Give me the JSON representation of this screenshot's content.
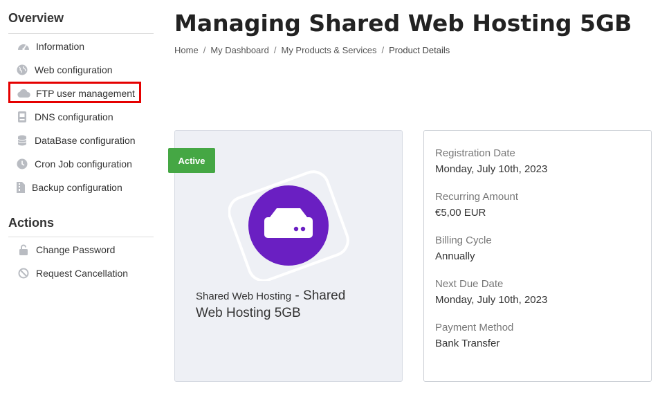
{
  "sidebar": {
    "overview_title": "Overview",
    "overview_items": [
      {
        "label": "Information",
        "icon": "dashboard-gauge-icon"
      },
      {
        "label": "Web configuration",
        "icon": "globe-icon"
      },
      {
        "label": "FTP user management",
        "icon": "cloud-icon",
        "highlighted": true
      },
      {
        "label": "DNS configuration",
        "icon": "dns-server-icon"
      },
      {
        "label": "DataBase configuration",
        "icon": "database-icon"
      },
      {
        "label": "Cron Job configuration",
        "icon": "clock-icon"
      },
      {
        "label": "Backup configuration",
        "icon": "file-archive-icon"
      }
    ],
    "actions_title": "Actions",
    "action_items": [
      {
        "label": "Change Password",
        "icon": "unlock-icon"
      },
      {
        "label": "Request Cancellation",
        "icon": "ban-icon"
      }
    ]
  },
  "header": {
    "title": "Managing Shared Web Hosting 5GB",
    "breadcrumb": [
      "Home",
      "My Dashboard",
      "My Products & Services",
      "Product Details"
    ]
  },
  "product": {
    "status": "Active",
    "group": "Shared Web Hosting",
    "separator": " - ",
    "name": "Shared Web Hosting 5GB",
    "icon": "hdd-server-icon",
    "status_color": "#45a744",
    "icon_color": "#6a1fc2"
  },
  "details": [
    {
      "label": "Registration Date",
      "value": "Monday, July 10th, 2023"
    },
    {
      "label": "Recurring Amount",
      "value": "€5,00 EUR"
    },
    {
      "label": "Billing Cycle",
      "value": "Annually"
    },
    {
      "label": "Next Due Date",
      "value": "Monday, July 10th, 2023"
    },
    {
      "label": "Payment Method",
      "value": "Bank Transfer"
    }
  ]
}
